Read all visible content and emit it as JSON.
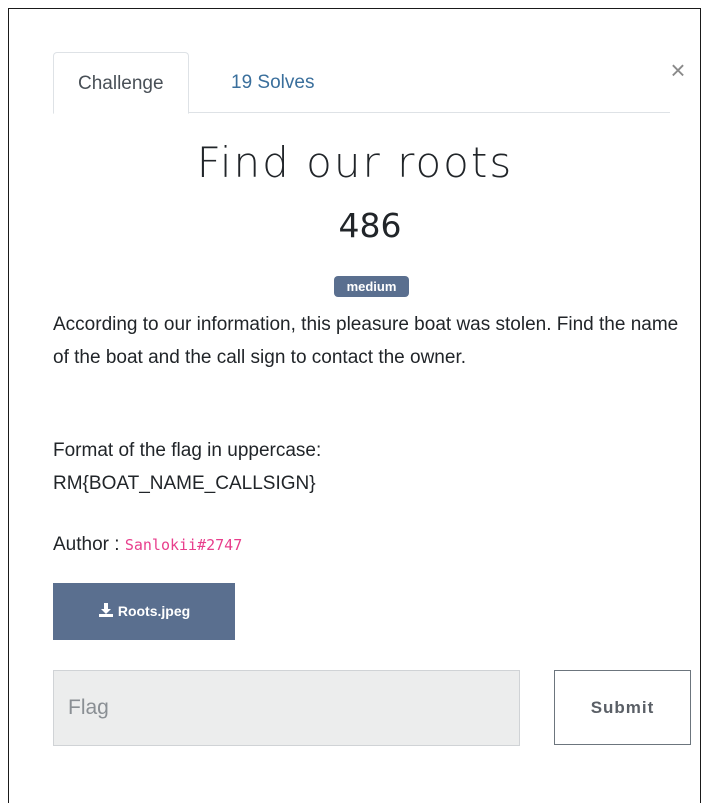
{
  "modal": {
    "close_symbol": "×",
    "tabs": [
      {
        "label": "Challenge",
        "active": true
      },
      {
        "label": "19 Solves",
        "active": false
      }
    ]
  },
  "challenge": {
    "title": "Find our roots",
    "points": "486",
    "difficulty": "medium",
    "description_1": "According to our information, this pleasure boat was stolen. Find the name of the boat and the call sign to contact the owner.",
    "description_2_line_1": "Format of the flag in uppercase:",
    "description_2_line_2": "RM{BOAT_NAME_CALLSIGN}",
    "author_label": "Author : ",
    "author_name": "Sanlokii#2747",
    "file_name": "Roots.jpeg"
  },
  "form": {
    "flag_placeholder": "Flag",
    "flag_value": "",
    "submit_label": "Submit"
  },
  "colors": {
    "badge": "#5a6f8f",
    "file_button": "#5a6f8f",
    "tab_link": "#3a6f9c",
    "author_code": "#e83e8c"
  },
  "icons": {
    "close": "close-icon",
    "download": "download-icon"
  }
}
